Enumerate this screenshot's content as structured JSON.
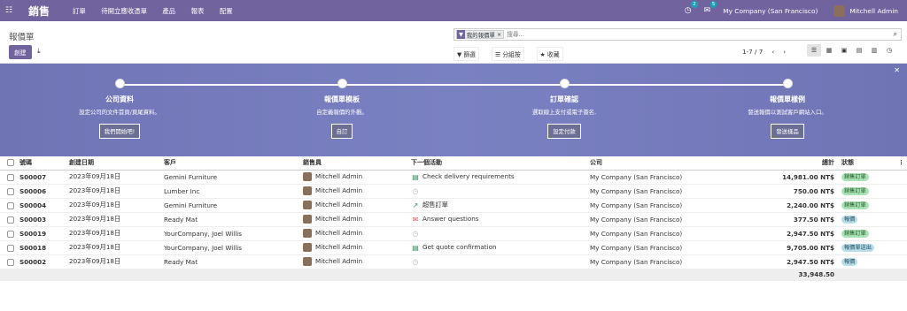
{
  "topbar": {
    "app_name": "銷售",
    "menu": [
      "訂單",
      "待開立應收憑單",
      "產品",
      "報表",
      "配置"
    ],
    "activity_count": "2",
    "message_count": "5",
    "company": "My Company (San Francisco)",
    "user": "Mitchell Admin"
  },
  "cp": {
    "title": "報價單",
    "new_label": "創建",
    "facet_label": "我的報價單",
    "search_placeholder": "搜尋...",
    "filter": "篩選",
    "group": "分組按",
    "fav": "收藏",
    "pager": "1-7 / 7"
  },
  "banner": {
    "steps": [
      {
        "title": "公司資料",
        "desc": "設定公司的文件首頁/頁尾資料。",
        "button": "我們開始吧!"
      },
      {
        "title": "報價單模板",
        "desc": "自定義報價的外觀。",
        "button": "自訂"
      },
      {
        "title": "訂單確認",
        "desc": "選取線上支付或電子簽名.",
        "button": "設定付款"
      },
      {
        "title": "報價單樣例",
        "desc": "發送報價以測試客戶網站入口。",
        "button": "發送樣品"
      }
    ]
  },
  "table": {
    "headers": [
      "號碼",
      "創建日期",
      "客戶",
      "銷售員",
      "下一個活動",
      "公司",
      "總計",
      "狀態"
    ],
    "rows": [
      {
        "no": "S00007",
        "date": "2023年09月18日",
        "customer": "Gemini Furniture",
        "salesperson": "Mitchell Admin",
        "activity": "Check delivery requirements",
        "activity_icon": "spreadsheet-icon",
        "company": "My Company (San Francisco)",
        "total": "14,981.00 NT$",
        "status": "銷售訂單",
        "status_color": "green"
      },
      {
        "no": "S00006",
        "date": "2023年09月18日",
        "customer": "Lumber Inc",
        "salesperson": "Mitchell Admin",
        "activity": "",
        "activity_icon": "clock-icon",
        "company": "My Company (San Francisco)",
        "total": "750.00 NT$",
        "status": "銷售訂單",
        "status_color": "green"
      },
      {
        "no": "S00004",
        "date": "2023年09月18日",
        "customer": "Gemini Furniture",
        "salesperson": "Mitchell Admin",
        "activity": "超售訂單",
        "activity_icon": "chart-line-icon",
        "company": "My Company (San Francisco)",
        "total": "2,240.00 NT$",
        "status": "銷售訂單",
        "status_color": "green"
      },
      {
        "no": "S00003",
        "date": "2023年09月18日",
        "customer": "Ready Mat",
        "salesperson": "Mitchell Admin",
        "activity": "Answer questions",
        "activity_icon": "envelope-icon",
        "company": "My Company (San Francisco)",
        "total": "377.50 NT$",
        "status": "報價",
        "status_color": "blue"
      },
      {
        "no": "S00019",
        "date": "2023年09月18日",
        "customer": "YourCompany, Joel Willis",
        "salesperson": "Mitchell Admin",
        "activity": "",
        "activity_icon": "clock-icon",
        "company": "My Company (San Francisco)",
        "total": "2,947.50 NT$",
        "status": "銷售訂單",
        "status_color": "green"
      },
      {
        "no": "S00018",
        "date": "2023年09月18日",
        "customer": "YourCompany, Joel Willis",
        "salesperson": "Mitchell Admin",
        "activity": "Get quote confirmation",
        "activity_icon": "spreadsheet-icon",
        "company": "My Company (San Francisco)",
        "total": "9,705.00 NT$",
        "status": "報價單送出",
        "status_color": "blue"
      },
      {
        "no": "S00002",
        "date": "2023年09月18日",
        "customer": "Ready Mat",
        "salesperson": "Mitchell Admin",
        "activity": "",
        "activity_icon": "clock-icon",
        "company": "My Company (San Francisco)",
        "total": "2,947.50 NT$",
        "status": "報價",
        "status_color": "blue"
      }
    ],
    "sum": "33,948.50"
  }
}
